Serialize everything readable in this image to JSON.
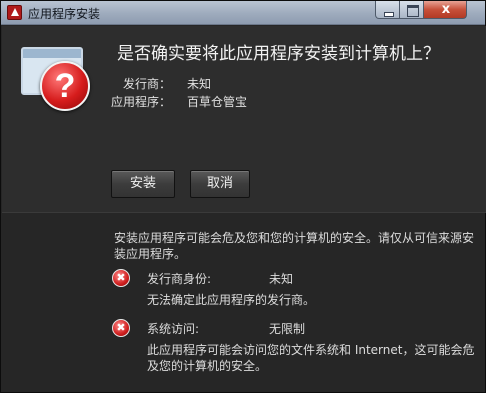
{
  "window": {
    "title": "应用程序安装",
    "close_glyph": "x"
  },
  "prompt": {
    "question": "是否确实要将此应用程序安装到计算机上？",
    "publisher_label": "发行商：",
    "publisher_value": "未知",
    "app_label": "应用程序：",
    "app_value": "百草仓管宝",
    "warning_glyph": "?"
  },
  "buttons": {
    "install": "安装",
    "cancel": "取消"
  },
  "warning": {
    "text": "安装应用程序可能会危及您和您的计算机的安全。请仅从可信来源安装应用程序。"
  },
  "risks": [
    {
      "name": "发行商身份:",
      "value": "未知",
      "desc": "无法确定此应用程序的发行商。",
      "icon_glyph": "✖"
    },
    {
      "name": "系统访问:",
      "value": "无限制",
      "desc": "此应用程序可能会访问您的文件系统和 Internet，这可能会危及您的计算机的安全。",
      "icon_glyph": "✖"
    }
  ]
}
